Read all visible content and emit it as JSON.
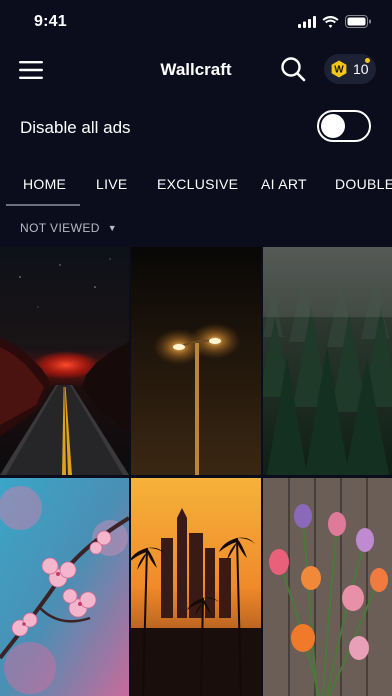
{
  "status_bar": {
    "time": "9:41"
  },
  "header": {
    "title": "Wallcraft",
    "coin": {
      "letter": "W",
      "count": "10"
    }
  },
  "ads": {
    "label": "Disable all ads",
    "enabled": false
  },
  "tabs": [
    {
      "label": "HOME",
      "active": true
    },
    {
      "label": "LIVE",
      "active": false
    },
    {
      "label": "EXCLUSIVE",
      "active": false
    },
    {
      "label": "AI ART",
      "active": false
    },
    {
      "label": "DOUBLE",
      "active": false
    }
  ],
  "filter": {
    "label": "NOT VIEWED"
  },
  "wallpapers": [
    {
      "subject": "road with red sunset"
    },
    {
      "subject": "street lamp at night"
    },
    {
      "subject": "misty pine forest"
    },
    {
      "subject": "pink cherry blossom"
    },
    {
      "subject": "city skyline with palm trees at sunset"
    },
    {
      "subject": "tulips on wooden boards"
    }
  ],
  "colors": {
    "background": "#0b0d1c",
    "accent": "#f5c61a"
  }
}
